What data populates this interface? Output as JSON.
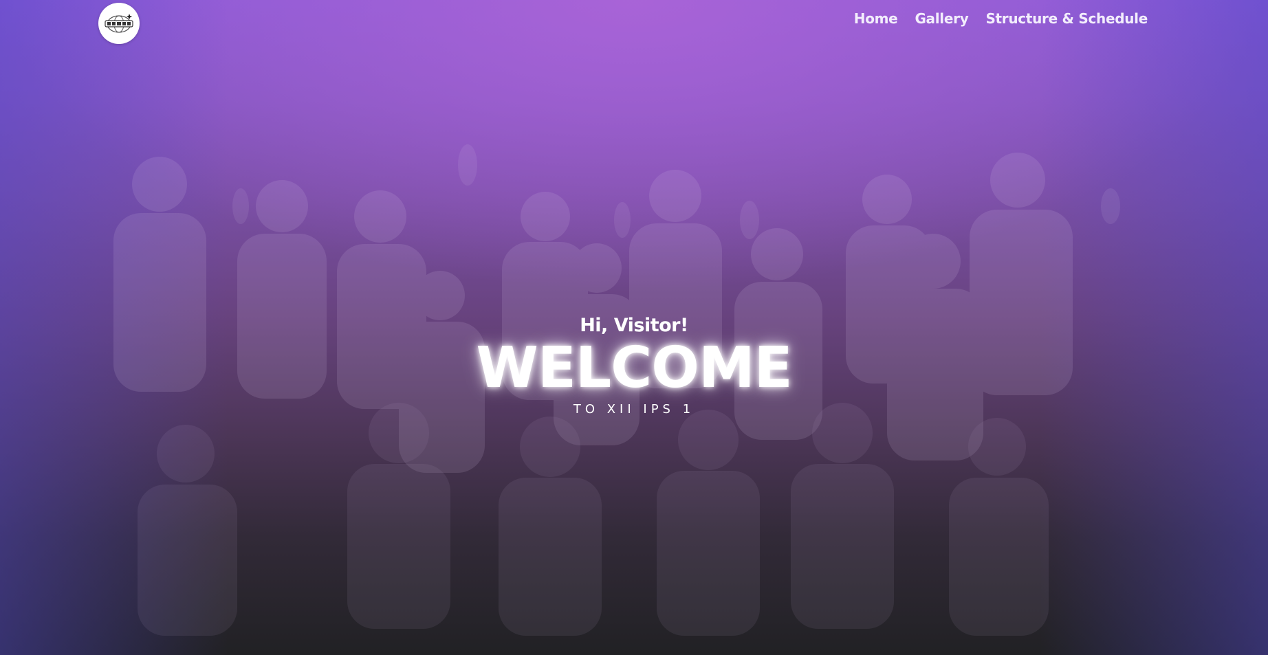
{
  "nav": {
    "logo_icon": "class-logo-icon",
    "links": [
      {
        "label": "Home"
      },
      {
        "label": "Gallery"
      },
      {
        "label": "Structure & Schedule"
      }
    ]
  },
  "hero": {
    "greeting": "Hi, Visitor!",
    "title": "WELCOME",
    "subtitle": "TO XII IPS 1",
    "colors": {
      "top": "#9a63d6",
      "bottom": "#212124",
      "text": "#ffffff"
    }
  }
}
